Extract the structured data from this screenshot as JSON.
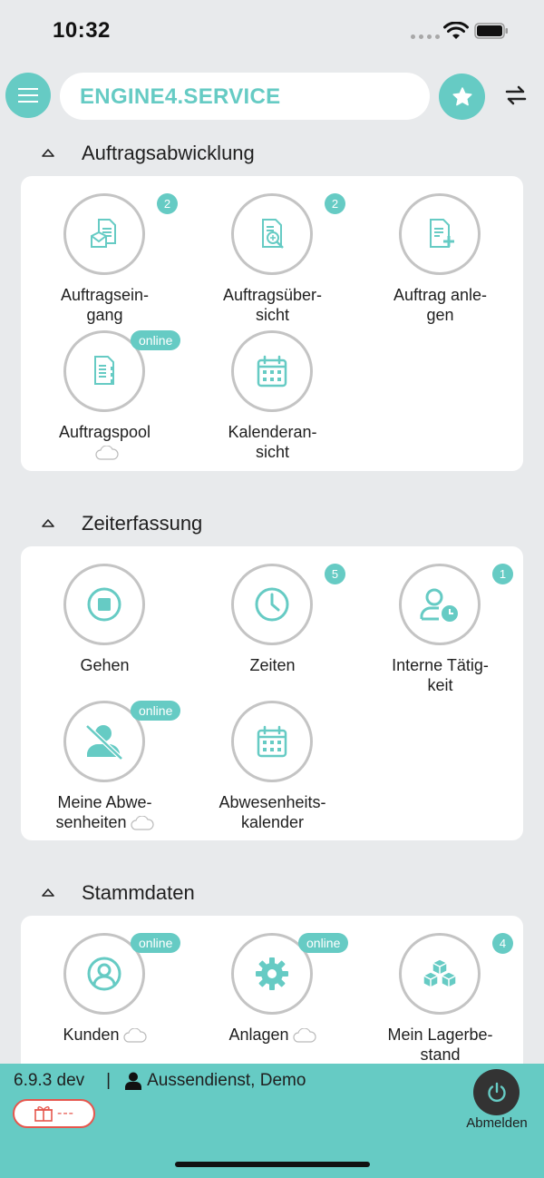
{
  "status_bar": {
    "time": "10:32"
  },
  "header": {
    "brand": "ENGINE4.SERVICE"
  },
  "colors": {
    "accent": "#66cbc4",
    "circle_border": "#c4c4c4",
    "chip_red": "#e6564d",
    "background": "#e8eaec"
  },
  "sections": [
    {
      "title": "Auftragsabwicklung",
      "tiles": [
        {
          "label": "Auftragsein-\ngang",
          "icon": "inbox-document-icon",
          "badge": "2"
        },
        {
          "label": "Auftragsüber-\nsicht",
          "icon": "document-search-icon",
          "badge": "2"
        },
        {
          "label": "Auftrag anle-\ngen",
          "icon": "document-add-icon",
          "badge": ""
        },
        {
          "label": "Auftragspool",
          "icon": "document-list-icon",
          "badge": "online",
          "cloud": true
        },
        {
          "label": "Kalenderan-\nsicht",
          "icon": "calendar-icon",
          "badge": ""
        }
      ]
    },
    {
      "title": "Zeiterfassung",
      "tiles": [
        {
          "label": "Gehen",
          "icon": "stop-icon",
          "badge": ""
        },
        {
          "label": "Zeiten",
          "icon": "clock-icon",
          "badge": "5"
        },
        {
          "label": "Interne Tätig-\nkeit",
          "icon": "person-clock-icon",
          "badge": "1"
        },
        {
          "label": "Meine Abwe-\nsenheiten",
          "icon": "person-off-icon",
          "badge": "online",
          "cloud": true
        },
        {
          "label": "Abwesenheits-\nkalender",
          "icon": "calendar-icon",
          "badge": ""
        }
      ]
    },
    {
      "title": "Stammdaten",
      "tiles": [
        {
          "label": "Kunden",
          "icon": "customer-icon",
          "badge": "online",
          "cloud": true
        },
        {
          "label": "Anlagen",
          "icon": "gear-icon",
          "badge": "online",
          "cloud": true
        },
        {
          "label": "Mein Lagerbe-\nstand",
          "icon": "boxes-icon",
          "badge": "4"
        }
      ]
    }
  ],
  "footer": {
    "version": "6.9.3 dev",
    "separator": "|",
    "user": "Aussendienst, Demo",
    "chip_text": "---",
    "logout_label": "Abmelden"
  }
}
